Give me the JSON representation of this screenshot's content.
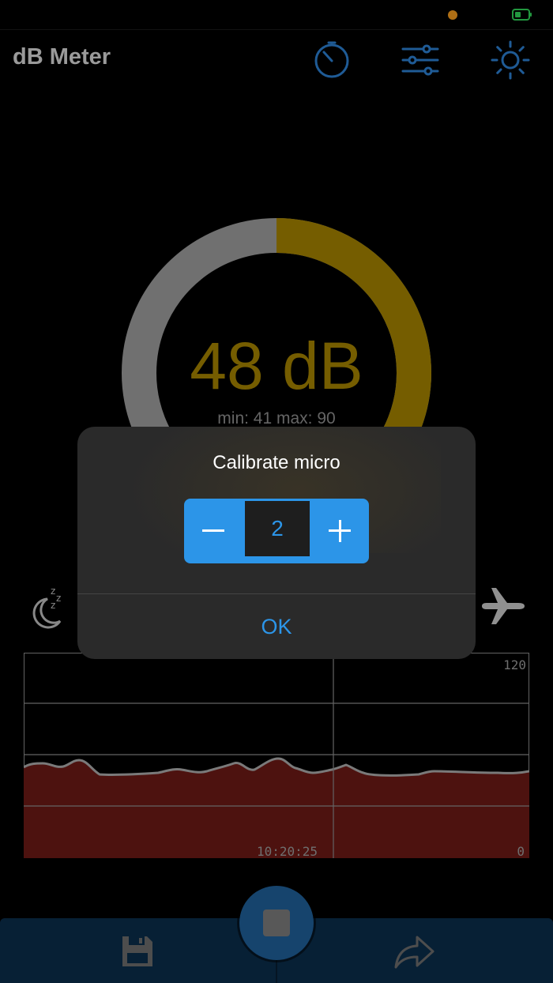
{
  "app": {
    "title": "dB Meter"
  },
  "header_icons": {
    "timer": "timer-icon",
    "settings": "sliders-icon",
    "brightness": "brightness-icon"
  },
  "gauge": {
    "reading": "48 dB",
    "minmax": "min: 41 max: 90",
    "level_fraction": 0.48,
    "active_color": "#a38200",
    "track_color": "#9c9c9c"
  },
  "graph": {
    "top_label": "120",
    "time_label": "10:20:25",
    "bottom_label": "0",
    "fill_color": "#6b1a16"
  },
  "mode_icons": {
    "sleep": "sleep-icon",
    "airplane": "airplane-icon"
  },
  "bottom_bar": {
    "save": "save-icon",
    "stop": "stop-icon",
    "share": "share-icon"
  },
  "dialog": {
    "title": "Calibrate micro",
    "value": "2",
    "ok_label": "OK",
    "accent_color": "#2c95e8"
  },
  "status_bar": {
    "mic_indicator_color": "#f39a1e",
    "battery_color": "#30d158"
  }
}
